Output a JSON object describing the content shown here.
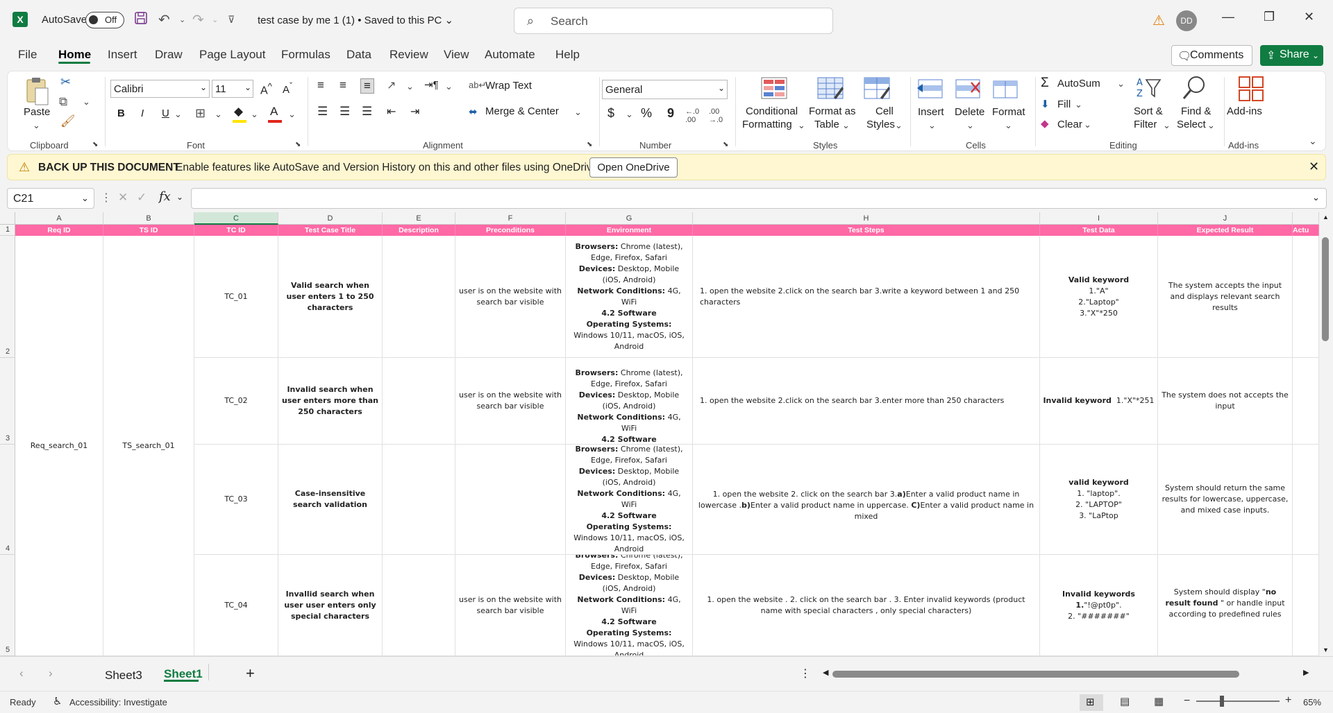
{
  "titlebar": {
    "app_icon": "X",
    "autosave_label": "AutoSave",
    "autosave_state": "Off",
    "doc_title": "test case by me 1 (1)  •  Saved to this PC",
    "search_placeholder": "Search",
    "avatar": "DD"
  },
  "menu": {
    "items": [
      "File",
      "Home",
      "Insert",
      "Draw",
      "Page Layout",
      "Formulas",
      "Data",
      "Review",
      "View",
      "Automate",
      "Help"
    ],
    "comments": "Comments",
    "share": "Share"
  },
  "ribbon": {
    "clipboard": {
      "label": "Clipboard",
      "paste": "Paste"
    },
    "font": {
      "label": "Font",
      "name": "Calibri",
      "size": "11",
      "bold": "B",
      "italic": "I",
      "underline": "U"
    },
    "alignment": {
      "label": "Alignment",
      "wrap": "Wrap Text",
      "merge": "Merge & Center"
    },
    "number": {
      "label": "Number",
      "format": "General",
      "currency": "$",
      "percent": "%",
      "comma": "9"
    },
    "styles": {
      "label": "Styles",
      "conditional_1": "Conditional",
      "conditional_2": "Formatting",
      "format_table_1": "Format as",
      "format_table_2": "Table",
      "cell_styles_1": "Cell",
      "cell_styles_2": "Styles"
    },
    "cells": {
      "label": "Cells",
      "insert": "Insert",
      "delete": "Delete",
      "format": "Format"
    },
    "editing": {
      "label": "Editing",
      "autosum": "AutoSum",
      "fill": "Fill",
      "clear": "Clear",
      "sort_1": "Sort &",
      "sort_2": "Filter",
      "find_1": "Find &",
      "find_2": "Select"
    },
    "addins": {
      "label": "Add-ins",
      "addins": "Add-ins"
    }
  },
  "notification": {
    "title": "BACK UP THIS DOCUMENT",
    "message": "Enable features like AutoSave and Version History on this and other files using OneDrive.",
    "button": "Open OneDrive"
  },
  "formula_bar": {
    "name_box": "C21",
    "fx": "fx",
    "value": ""
  },
  "grid": {
    "columns": [
      "A",
      "B",
      "C",
      "D",
      "E",
      "F",
      "G",
      "H",
      "I",
      "J"
    ],
    "rows": [
      "1",
      "2",
      "3",
      "4",
      "5"
    ],
    "headers": [
      "Req ID",
      "TS ID",
      "TC ID",
      "Test Case Title",
      "Description",
      "Preconditions",
      "Environment",
      "Test Steps",
      "Test Data",
      "Expected Result",
      "Actu"
    ],
    "req_id": "Req_search_01",
    "ts_id": "TS_search_01",
    "env_labels": {
      "browsers": "Browsers:",
      "devices": "Devices:",
      "network": "Network Conditions:",
      "software": "4.2 Software",
      "os": "Operating Systems:"
    },
    "env_values": {
      "browsers": " Chrome (latest), Edge, Firefox, Safari",
      "devices": " Desktop, Mobile (iOS, Android)",
      "network": " 4G, WiFi",
      "os": " Windows 10/11, macOS, iOS, Android"
    },
    "rows_data": [
      {
        "tc": "TC_01",
        "title": "Valid search when user enters 1 to 250 characters",
        "pre": "user is on the website with search bar visible",
        "steps": "1. open the website 2.click on the search bar 3.write a keyword between 1 and 250 characters",
        "data_title": "Valid keyword",
        "data": "1.\"A\"\n2.\"Laptop\"\n3.\"X\"*250",
        "expected": "The system accepts the input and displays relevant search results"
      },
      {
        "tc": "TC_02",
        "title": "Invalid search when user enters more than 250 characters",
        "pre": "user is on the website with search bar visible",
        "steps": "1. open the website 2.click on the search bar 3.enter more than 250 characters",
        "data_title": "Invalid keyword",
        "data": "1.\"X\"*251",
        "expected": "The system does not accepts the input"
      },
      {
        "tc": "TC_03",
        "title": "Case-insensitive search validation",
        "pre": "",
        "steps_a": "1. open the website 2. click on the search bar   3.",
        "steps_a_b": "a)",
        "steps_b": "Enter a valid product name in lowercase .",
        "steps_c_b": "b)",
        "steps_c": "Enter a valid product name in uppercase. ",
        "steps_d_b": "C)",
        "steps_d": "Enter a valid product name in mixed",
        "data_title": "valid keyword",
        "data": "1. \"laptop\".\n2. \"LAPTOP\"\n3. \"LaPtop",
        "expected": "System should return the same results for lowercase, uppercase, and mixed case inputs."
      },
      {
        "tc": "TC_04",
        "title": "Invallid search when user user enters only special characters",
        "pre": "user is on the website with search bar visible",
        "steps": "1. open the website . 2. click on the search bar . 3. Enter invalid keywords (product name with special characters , only special characters)",
        "data_title": "Invalid keywords",
        "data_1": "1.",
        "data_1b": "\"!@pt0p\".",
        "data_2": "2. \"#######\"",
        "expected_a": "System should display \"",
        "expected_b": "no result found",
        "expected_c": " \" or handle input according to predefined rules"
      }
    ]
  },
  "sheets": {
    "tabs": [
      "Sheet3",
      "Sheet1"
    ],
    "active": "Sheet1"
  },
  "status": {
    "ready": "Ready",
    "accessibility": "Accessibility: Investigate",
    "zoom": "65%",
    "minus": "−",
    "plus": "+"
  }
}
